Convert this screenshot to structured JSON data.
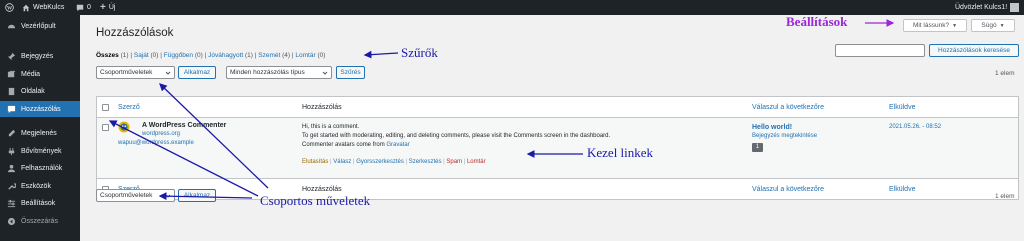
{
  "adminbar": {
    "site_name": "WebKulcs",
    "comments_count": "0",
    "new_label": "Új",
    "greeting": "Üdvözlet Kulcs1!"
  },
  "sidebar": {
    "items": [
      {
        "label": "Vezérlőpult",
        "icon": "dashboard-icon"
      },
      {
        "label": "Bejegyzés",
        "icon": "pin-icon"
      },
      {
        "label": "Média",
        "icon": "media-icon"
      },
      {
        "label": "Oldalak",
        "icon": "pages-icon"
      },
      {
        "label": "Hozzászólás",
        "icon": "comments-icon"
      },
      {
        "label": "Megjelenés",
        "icon": "appearance-icon"
      },
      {
        "label": "Bővítmények",
        "icon": "plugins-icon"
      },
      {
        "label": "Felhasználók",
        "icon": "users-icon"
      },
      {
        "label": "Eszközök",
        "icon": "tools-icon"
      },
      {
        "label": "Beállítások",
        "icon": "settings-icon"
      },
      {
        "label": "Összezárás",
        "icon": "collapse-icon"
      }
    ]
  },
  "screen_options": {
    "screen_label": "Mit lássunk?",
    "help_label": "Súgó"
  },
  "page": {
    "title": "Hozzászólások"
  },
  "filters": {
    "all": "Összes",
    "all_count": "(1)",
    "mine": "Saját",
    "mine_count": "(0)",
    "pending": "Függőben",
    "pending_count": "(0)",
    "approved": "Jóváhagyott",
    "approved_count": "(1)",
    "spam": "Szemét",
    "spam_count": "(4)",
    "trash": "Lomtár",
    "trash_count": "(0)"
  },
  "search": {
    "button_label": "Hozzászólások keresése",
    "value": ""
  },
  "toolbar": {
    "bulk_select": "Csoportműveletek",
    "apply_label": "Alkalmaz",
    "type_select": "Minden hozzászólás típus",
    "filter_label": "Szűrés",
    "count": "1 elem"
  },
  "table": {
    "headers": {
      "author": "Szerző",
      "comment": "Hozzászólás",
      "response": "Válaszul a következőre",
      "submitted": "Elküldve"
    },
    "row": {
      "author_name": "A WordPress Commenter",
      "author_url": "wordpress.org",
      "author_email": "wapuu@wordpress.example",
      "comment_lines": [
        "Hi, this is a comment.",
        "To get started with moderating, editing, and deleting comments, please visit the Comments screen in the dashboard."
      ],
      "comment_line3_prefix": "Commenter avatars come from",
      "comment_line3_link": "Gravatar",
      "actions": {
        "unapprove": "Elutasítás",
        "reply": "Válasz",
        "quick_edit": "Gyorsszerkesztés",
        "edit": "Szerkesztés",
        "spam": "Spam",
        "trash": "Lomtár"
      },
      "post_title": "Hello world!",
      "post_view": "Bejegyzés megtekintése",
      "post_comment_count": "1",
      "date": "2021.05.26. - 08:52"
    }
  },
  "annotations": {
    "settings": "Beállítások",
    "filters": "Szűrők",
    "links": "Kezel linkek",
    "bulk": "Csoportos műveletek"
  },
  "colors": {
    "adminbar_bg": "#1d2327",
    "active_menu": "#2271b1",
    "link": "#2271b1",
    "spam_trash": "#b32d2e",
    "annotation_blue": "#1a1aa8",
    "annotation_purple": "#9b27d8"
  }
}
